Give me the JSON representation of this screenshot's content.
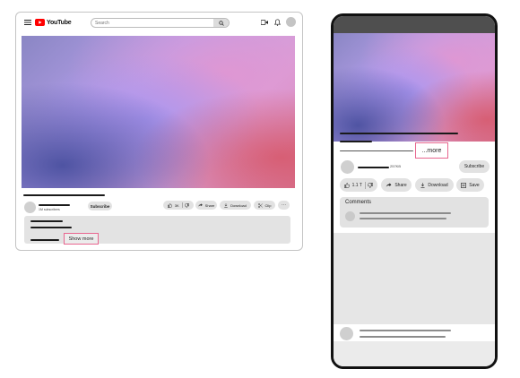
{
  "desktop": {
    "logo_text": "YouTube",
    "search": {
      "placeholder": "Search"
    },
    "channel": {
      "subscribers": "1M subscribers"
    },
    "subscribe_label": "Subscribe",
    "actions": {
      "like_count": "3K",
      "share": "Share",
      "download": "Download",
      "clip": "Clip",
      "more": "···"
    },
    "show_more": "Show more"
  },
  "mobile": {
    "more": "...more",
    "channel": {
      "subscribers": "257KB"
    },
    "subscribe_label": "Subscribe",
    "actions": {
      "like_count": "1.1 T",
      "share": "Share",
      "download": "Download",
      "save": "Save"
    },
    "comments_label": "Comments"
  },
  "colors": {
    "brand_red": "#ff0000",
    "highlight_border": "#e8668f"
  }
}
